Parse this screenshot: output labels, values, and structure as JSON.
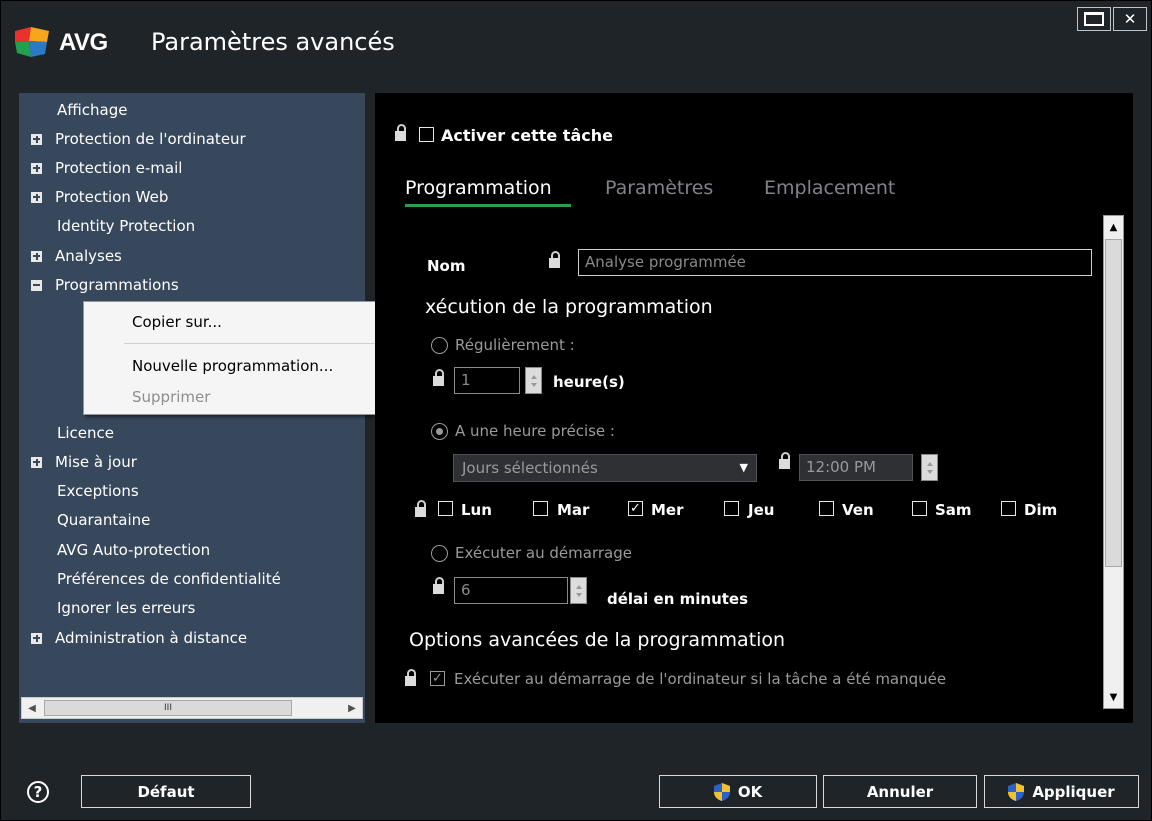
{
  "titlebar": {
    "brand": "AVG",
    "title": "Paramètres avancés"
  },
  "sidebar": {
    "items": [
      {
        "label": "Affichage",
        "expander": "none"
      },
      {
        "label": "Protection de l'ordinateur",
        "expander": "plus"
      },
      {
        "label": "Protection e-mail",
        "expander": "plus"
      },
      {
        "label": "Protection Web",
        "expander": "plus"
      },
      {
        "label": "Identity Protection",
        "expander": "none"
      },
      {
        "label": "Analyses",
        "expander": "plus"
      },
      {
        "label": "Programmations",
        "expander": "minus"
      },
      {
        "label": "Licence",
        "expander": "none"
      },
      {
        "label": "Mise à jour",
        "expander": "plus"
      },
      {
        "label": "Exceptions",
        "expander": "none"
      },
      {
        "label": "Quarantaine",
        "expander": "none"
      },
      {
        "label": "AVG Auto-protection",
        "expander": "none"
      },
      {
        "label": "Préférences de confidentialité",
        "expander": "none"
      },
      {
        "label": "Ignorer les erreurs",
        "expander": "none"
      },
      {
        "label": "Administration à distance",
        "expander": "plus"
      }
    ],
    "scroll_thumb_glyph": "III"
  },
  "context_menu": {
    "items": [
      {
        "label": "Copier sur...",
        "enabled": true
      },
      {
        "label": "Nouvelle programmation...",
        "enabled": true
      },
      {
        "label": "Supprimer",
        "enabled": false
      }
    ]
  },
  "panel": {
    "activate_task_label": "Activer cette tâche",
    "activate_task_checked": false,
    "tabs": [
      {
        "label": "Programmation",
        "active": true
      },
      {
        "label": "Paramètres",
        "active": false
      },
      {
        "label": "Emplacement",
        "active": false
      }
    ],
    "name_label": "Nom",
    "name_value": "Analyse programmée",
    "execution_heading": "xécution de la programmation",
    "regularly_label": "Régulièrement :",
    "regularly_selected": false,
    "hours_value": "1",
    "hours_unit": "heure(s)",
    "specific_time_label": "A une heure précise :",
    "specific_time_selected": true,
    "days_select_value": "Jours sélectionnés",
    "time_value": "12:00 PM",
    "days": [
      {
        "label": "Lun",
        "checked": false
      },
      {
        "label": "Mar",
        "checked": false
      },
      {
        "label": "Mer",
        "checked": true
      },
      {
        "label": "Jeu",
        "checked": false
      },
      {
        "label": "Ven",
        "checked": false
      },
      {
        "label": "Sam",
        "checked": false
      },
      {
        "label": "Dim",
        "checked": false
      }
    ],
    "startup_label": "Exécuter au démarrage",
    "startup_selected": false,
    "delay_value": "6",
    "delay_unit": "délai en minutes",
    "advanced_heading": "Options avancées de la programmation",
    "missed_task_label": "Exécuter au démarrage de l'ordinateur si la tâche a été manquée",
    "missed_task_checked": true
  },
  "footer": {
    "help_glyph": "?",
    "default_label": "Défaut",
    "ok_label": "OK",
    "cancel_label": "Annuler",
    "apply_label": "Appliquer"
  },
  "colors": {
    "window_bg": "#1f2428",
    "sidebar_bg": "#37485d",
    "panel_bg": "#000000",
    "tab_active_underline": "#2ea04a",
    "logo_colors": [
      "#e8322b",
      "#f7a51a",
      "#22a04b",
      "#2a7ac8"
    ]
  }
}
